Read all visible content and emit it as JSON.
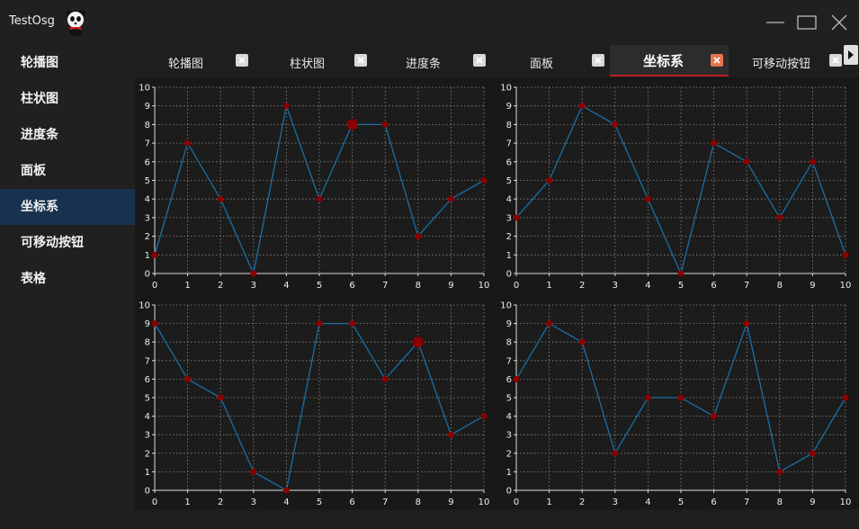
{
  "window": {
    "title": "TestOsg",
    "icon": "panda-logo"
  },
  "window_controls": [
    "minimize-icon",
    "maximize-icon",
    "close-icon"
  ],
  "sidebar": {
    "items": [
      {
        "label": "轮播图"
      },
      {
        "label": "柱状图"
      },
      {
        "label": "进度条"
      },
      {
        "label": "面板"
      },
      {
        "label": "坐标系",
        "active": true
      },
      {
        "label": "可移动按钮"
      },
      {
        "label": "表格"
      }
    ],
    "active_color": "#17324f"
  },
  "tabs": [
    {
      "label": "轮播图"
    },
    {
      "label": "柱状图"
    },
    {
      "label": "进度条"
    },
    {
      "label": "面板"
    },
    {
      "label": "坐标系",
      "active": true
    },
    {
      "label": "可移动按钮"
    }
  ],
  "colors": {
    "line": "#1a6fa8",
    "point": "#8b0000",
    "grid": "#8a8a8a",
    "active_tab_underline": "#c02020"
  },
  "chart_data": [
    {
      "type": "line",
      "x": [
        0,
        1,
        2,
        3,
        4,
        5,
        6,
        7,
        8,
        9,
        10
      ],
      "values": [
        1,
        7,
        4,
        0,
        9,
        4,
        8,
        8,
        2,
        4,
        5
      ],
      "xlim": [
        0,
        10
      ],
      "ylim": [
        0,
        10
      ],
      "grid": true,
      "highlight_index": 6
    },
    {
      "type": "line",
      "x": [
        0,
        1,
        2,
        3,
        4,
        5,
        6,
        7,
        8,
        9,
        10
      ],
      "values": [
        3,
        5,
        9,
        8,
        4,
        0,
        7,
        6,
        3,
        6,
        1
      ],
      "xlim": [
        0,
        10
      ],
      "ylim": [
        0,
        10
      ],
      "grid": true
    },
    {
      "type": "line",
      "x": [
        0,
        1,
        2,
        3,
        4,
        5,
        6,
        7,
        8,
        9,
        10
      ],
      "values": [
        9,
        6,
        5,
        1,
        0,
        9,
        9,
        6,
        8,
        3,
        4
      ],
      "xlim": [
        0,
        10
      ],
      "ylim": [
        0,
        10
      ],
      "grid": true,
      "highlight_index": 8
    },
    {
      "type": "line",
      "x": [
        0,
        1,
        2,
        3,
        4,
        5,
        6,
        7,
        8,
        9,
        10
      ],
      "values": [
        6,
        9,
        8,
        2,
        5,
        5,
        4,
        9,
        1,
        2,
        5
      ],
      "xlim": [
        0,
        10
      ],
      "ylim": [
        0,
        10
      ],
      "grid": true
    }
  ]
}
